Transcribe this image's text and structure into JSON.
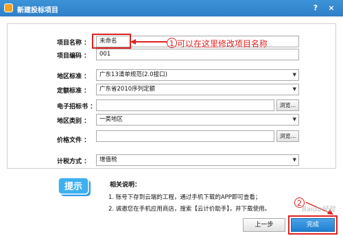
{
  "window": {
    "title": "新建投标项目",
    "help_label": "?",
    "close_label": "×"
  },
  "form": {
    "project_name_label": "项目名称 ：",
    "project_name_value": "未命名",
    "project_code_label": "项目编码 ：",
    "project_code_value": "001",
    "region_standard_label": "地区标准 ：",
    "region_standard_value": "广东13清单规范(2.0接口)",
    "quota_standard_label": "定额标准 ：",
    "quota_standard_value": "广东省2010序列定额",
    "e_tender_label": "电子招标书 ：",
    "e_tender_value": "",
    "region_category_label": "地区类别 ：",
    "region_category_value": "一类地区",
    "price_file_label": "价格文件 ：",
    "price_file_value": "",
    "tax_method_label": "计税方式 ：",
    "tax_method_value": "增值税",
    "browse_label": "浏览..."
  },
  "annotations": {
    "note1_number": "1",
    "note1_text": "可以在这里修改项目名称",
    "note2_number": "2"
  },
  "tips": {
    "logo_text": "提示",
    "title": "相关说明：",
    "items": [
      "1. 账号下存到云端的工程，通过手机下载的APP即可查看；",
      "2. 诚邀您在手机应用商店，搜索【云计价助手】，并下载使用。"
    ]
  },
  "buttons": {
    "prev_label": "上一步",
    "finish_label": "完成"
  },
  "watermark": "Baidu经验",
  "colors": {
    "titlebar": "#2f7fc7",
    "annotation": "#e02020"
  }
}
